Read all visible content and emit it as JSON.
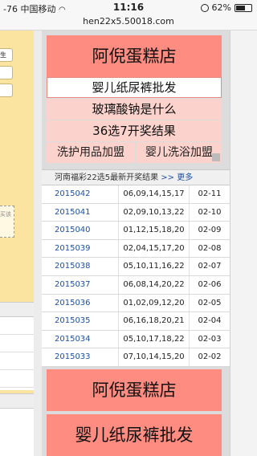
{
  "status_bar": {
    "signal": "-76",
    "carrier": "中国移动",
    "wifi_icon": "wifi-icon",
    "time": "11:16",
    "battery": "62%",
    "battery_level": 0.62
  },
  "address": {
    "url": "hen22x5.50018.com"
  },
  "left_panel": {
    "input_label": "生",
    "dashed_box_text": "买该"
  },
  "ads_top": {
    "big1": "阿倪蛋糕店",
    "outlined": "婴儿纸尿裤批发",
    "mid1": "玻璃酸钠是什么",
    "mid2": "36选7开奖结果",
    "half_left": "洗护用品加盟",
    "half_right": "婴儿洗浴加盟"
  },
  "lottery": {
    "title": "河南福彩22选5最新开奖结果",
    "more_label": ">> 更多",
    "rows": [
      {
        "issue": "2015042",
        "numbers": "06,09,14,15,17",
        "date": "02-11"
      },
      {
        "issue": "2015041",
        "numbers": "02,09,10,13,22",
        "date": "02-10"
      },
      {
        "issue": "2015040",
        "numbers": "01,12,15,18,20",
        "date": "02-09"
      },
      {
        "issue": "2015039",
        "numbers": "02,04,15,17,20",
        "date": "02-08"
      },
      {
        "issue": "2015038",
        "numbers": "05,10,11,16,22",
        "date": "02-07"
      },
      {
        "issue": "2015037",
        "numbers": "06,08,14,20,22",
        "date": "02-06"
      },
      {
        "issue": "2015036",
        "numbers": "01,02,09,12,20",
        "date": "02-05"
      },
      {
        "issue": "2015035",
        "numbers": "06,16,18,20,21",
        "date": "02-04"
      },
      {
        "issue": "2015034",
        "numbers": "05,10,17,18,22",
        "date": "02-03"
      },
      {
        "issue": "2015033",
        "numbers": "07,10,14,15,20",
        "date": "02-02"
      }
    ]
  },
  "ads_bottom": {
    "big1": "阿倪蛋糕店",
    "big2": "婴儿纸尿裤批发"
  }
}
